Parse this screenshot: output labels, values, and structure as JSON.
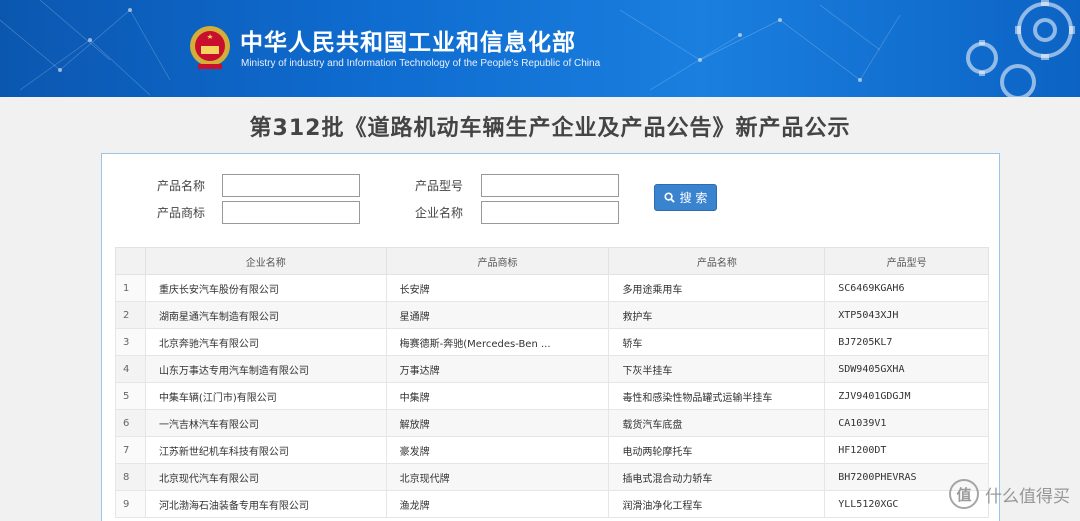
{
  "header": {
    "ministry_cn": "中华人民共和国工业和信息化部",
    "ministry_en": "Ministry of industry and Information Technology of the People's Republic of China"
  },
  "page_title": "第312批《道路机动车辆生产企业及产品公告》新产品公示",
  "search": {
    "product_name_label": "产品名称",
    "product_model_label": "产品型号",
    "product_brand_label": "产品商标",
    "company_name_label": "企业名称",
    "button_label": "搜 索"
  },
  "table": {
    "headers": [
      "",
      "企业名称",
      "产品商标",
      "产品名称",
      "产品型号"
    ],
    "rows": [
      [
        "1",
        "重庆长安汽车股份有限公司",
        "长安牌",
        "多用途乘用车",
        "SC6469KGAH6"
      ],
      [
        "2",
        "湖南星通汽车制造有限公司",
        "星通牌",
        "救护车",
        "XTP5043XJH"
      ],
      [
        "3",
        "北京奔驰汽车有限公司",
        "梅赛德斯-奔驰(Mercedes-Ben ...",
        "轿车",
        "BJ7205KL7"
      ],
      [
        "4",
        "山东万事达专用汽车制造有限公司",
        "万事达牌",
        "下灰半挂车",
        "SDW9405GXHA"
      ],
      [
        "5",
        "中集车辆(江门市)有限公司",
        "中集牌",
        "毒性和感染性物品罐式运输半挂车",
        "ZJV9401GDGJM"
      ],
      [
        "6",
        "一汽吉林汽车有限公司",
        "解放牌",
        "载货汽车底盘",
        "CA1039V1"
      ],
      [
        "7",
        "江苏新世纪机车科技有限公司",
        "豪发牌",
        "电动两轮摩托车",
        "HF1200DT"
      ],
      [
        "8",
        "北京现代汽车有限公司",
        "北京现代牌",
        "插电式混合动力轿车",
        "BH7200PHEVRAS"
      ],
      [
        "9",
        "河北渤海石油装备专用车有限公司",
        "渔龙牌",
        "润滑油净化工程车",
        "YLL5120XGC"
      ]
    ]
  },
  "watermark": {
    "mark": "值",
    "text": "什么值得买"
  }
}
